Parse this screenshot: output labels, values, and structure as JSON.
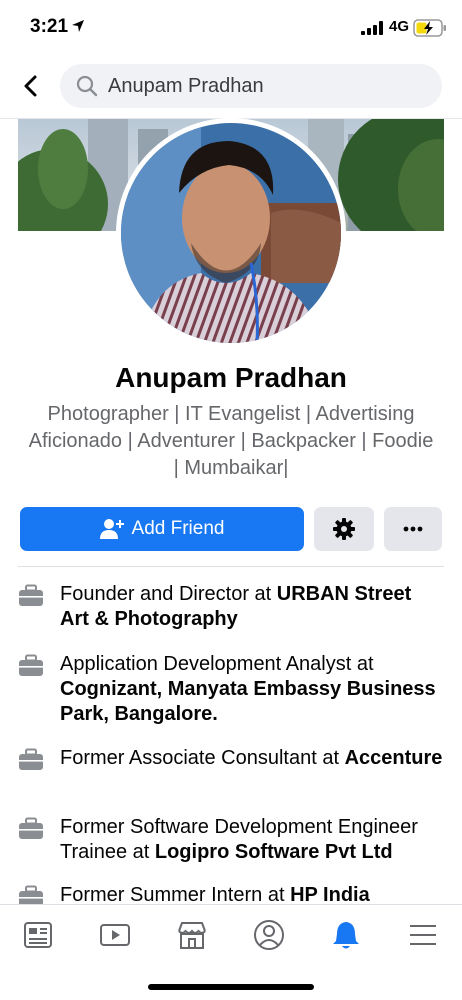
{
  "status_bar": {
    "time": "3:21",
    "network": "4G"
  },
  "search": {
    "value": "Anupam Pradhan"
  },
  "profile": {
    "name": "Anupam Pradhan",
    "bio": "Photographer | IT Evangelist | Advertising Aficionado | Adventurer | Backpacker | Foodie | Mumbaikar|"
  },
  "actions": {
    "add_friend_label": "Add Friend"
  },
  "work": [
    {
      "prefix": "Founder and Director at ",
      "org": "URBAN Street Art & Photography"
    },
    {
      "prefix": "Application Development Analyst at ",
      "org": "Cognizant, Manyata Embassy Business Park, Bangalore."
    },
    {
      "prefix": "Former Associate Consultant at ",
      "org": "Accenture"
    },
    {
      "prefix": "Former Software Development Engineer Trainee at ",
      "org": "Logipro Software Pvt Ltd"
    },
    {
      "prefix": "Former Summer Intern at ",
      "org": "HP India"
    }
  ],
  "bottom_nav": {
    "tabs": [
      "news-feed-icon",
      "watch-icon",
      "marketplace-icon",
      "profile-icon",
      "notifications-icon",
      "menu-icon"
    ],
    "active_tab": "notifications-icon"
  },
  "colors": {
    "accent": "#1877f2",
    "secondary_button": "#e4e6eb",
    "muted_text": "#65676b",
    "search_bg": "#f0f2f5"
  }
}
